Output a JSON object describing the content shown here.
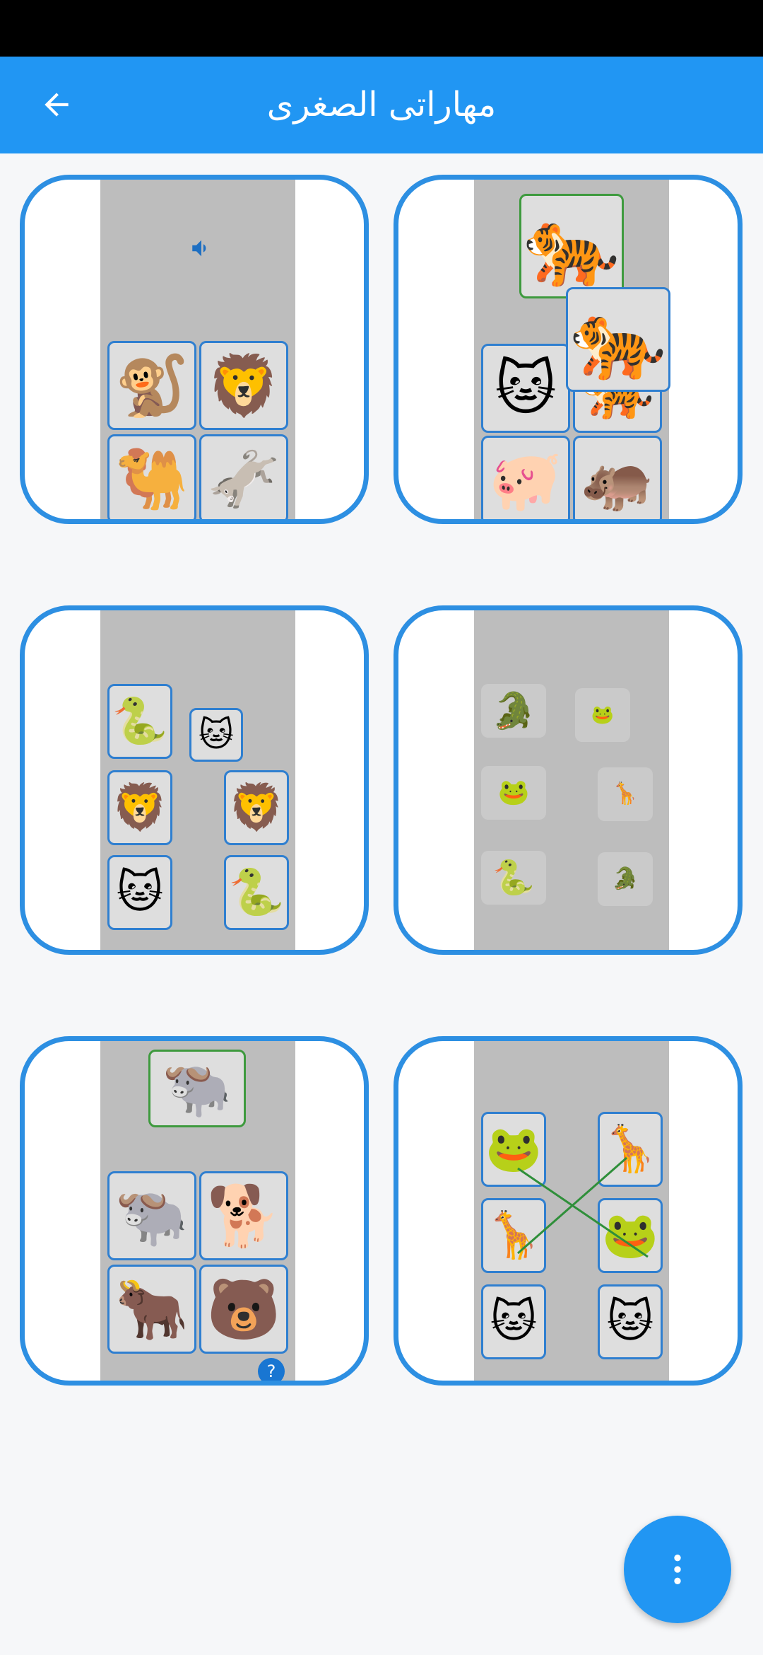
{
  "app": {
    "title": "مهاراتى الصغرى",
    "back_icon": "arrow-back-icon"
  },
  "colors": {
    "app_bar": "#2196F3",
    "card_border": "#2d8fe2",
    "tile_border": "#2f7fd0",
    "correct_border": "#3e9a3e",
    "scene_bg": "#bdbdbd"
  },
  "cards": [
    {
      "id": "tiger-match",
      "icons": [
        "tiger",
        "tiger",
        "cat",
        "tiger",
        "pig",
        "hippo"
      ]
    },
    {
      "id": "listen-choose",
      "icons": [
        "speaker-icon",
        "monkey",
        "lion",
        "camel",
        "donkey"
      ]
    },
    {
      "id": "shadow-puzzle",
      "icons": [
        "crocodile",
        "frog-piece",
        "frog",
        "giraffe-piece",
        "snake",
        "crocodile-piece"
      ]
    },
    {
      "id": "memory-pairs",
      "icons": [
        "snake",
        "cat",
        "lion",
        "lion",
        "cat",
        "snake"
      ]
    },
    {
      "id": "connect-lines",
      "icons": [
        "frog",
        "giraffe",
        "giraffe",
        "frog",
        "cat",
        "cat"
      ]
    },
    {
      "id": "buffalo-choose",
      "icons": [
        "buffalo",
        "buffalo",
        "hyena",
        "ox",
        "bear"
      ],
      "help_text": "?"
    }
  ],
  "fab": {
    "icon": "more-vertical-icon"
  }
}
